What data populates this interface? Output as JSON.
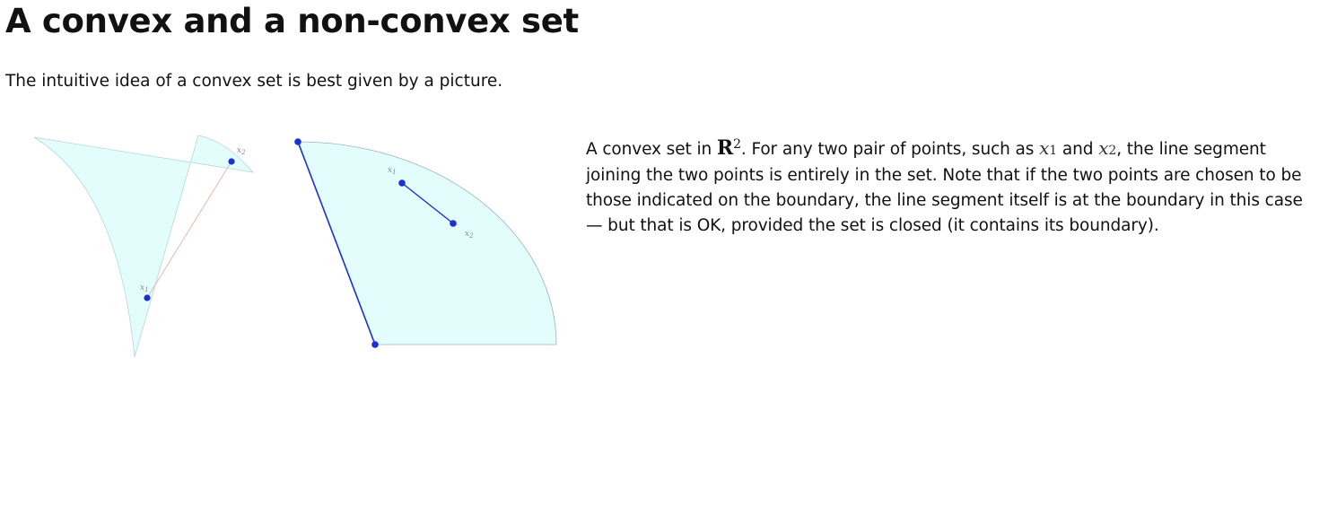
{
  "page": {
    "title": "A convex and a non-convex set",
    "intro": "The intuitive idea of a convex set is best given by a picture."
  },
  "figures": {
    "fill_color": "#e3fdfd",
    "segment_color": "#1a2fd6",
    "nonconvex": {
      "label_x1": "x",
      "label_x1_sub": "1",
      "label_x2": "x",
      "label_x2_sub": "2"
    },
    "convex": {
      "label_x1": "x",
      "label_x1_sub": "1",
      "label_x2": "x",
      "label_x2_sub": "2"
    }
  },
  "caption": {
    "part1": "A convex set in ",
    "set_symbol": "R",
    "set_exponent": "2",
    "part2": ". For any two pair of points, such as ",
    "x1_symbol": "x",
    "x1_sub": "1",
    "and": " and ",
    "x2_symbol": "x",
    "x2_sub": "2",
    "part3": ", the line segment joining the two points is entirely in the set. Note that if the two points are chosen to be those indicated on the boundary, the line segment itself is at the boundary in this case — but that is OK, provided the set is closed (it contains its boundary)."
  }
}
